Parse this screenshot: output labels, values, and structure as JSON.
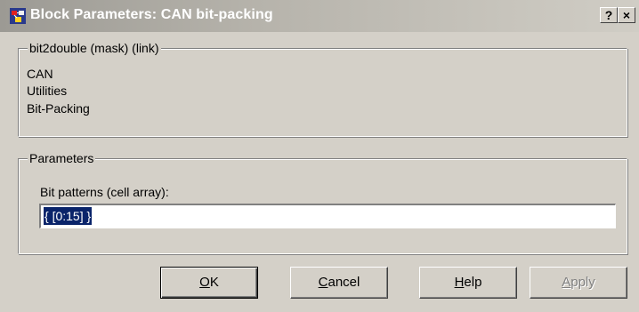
{
  "window": {
    "title": "Block Parameters: CAN bit-packing",
    "help_glyph": "?",
    "close_glyph": "×"
  },
  "description_group": {
    "legend": "bit2double (mask) (link)",
    "lines": [
      "CAN",
      "Utilities",
      "Bit-Packing"
    ]
  },
  "parameters_group": {
    "legend": "Parameters",
    "field_label": "Bit patterns (cell array):",
    "field_value": "{ [0:15] }"
  },
  "buttons": {
    "ok": {
      "mnemonic": "O",
      "rest": "K"
    },
    "cancel": {
      "mnemonic": "C",
      "rest": "ancel"
    },
    "help": {
      "mnemonic": "H",
      "rest": "elp"
    },
    "apply": {
      "mnemonic": "A",
      "rest": "pply",
      "enabled": false
    }
  },
  "icons": {
    "app": "simulink-block-icon",
    "help": "help-question-icon",
    "close": "close-x-icon"
  }
}
